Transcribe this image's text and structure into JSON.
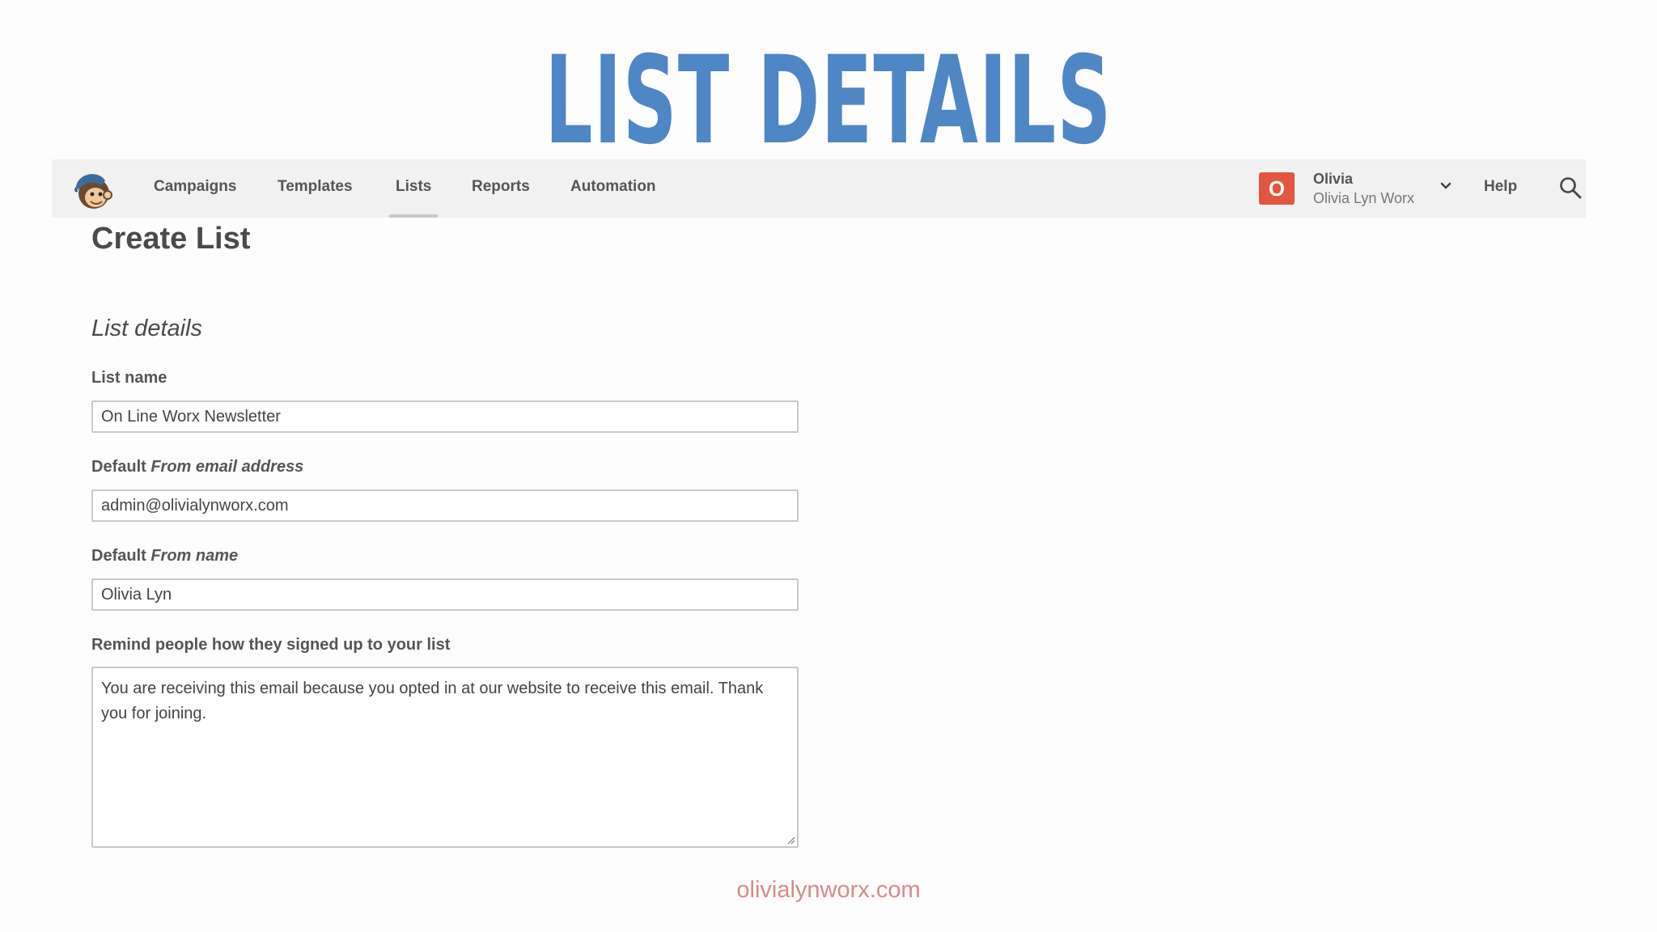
{
  "slide": {
    "title": "LIST DETAILS",
    "footer": "olivialynworx.com"
  },
  "nav": {
    "items": [
      {
        "label": "Campaigns",
        "active": false
      },
      {
        "label": "Templates",
        "active": false
      },
      {
        "label": "Lists",
        "active": true
      },
      {
        "label": "Reports",
        "active": false
      },
      {
        "label": "Automation",
        "active": false
      }
    ],
    "user": {
      "initial": "O",
      "name": "Olivia",
      "account": "Olivia Lyn Worx"
    },
    "help": "Help",
    "icons": {
      "logo": "mailchimp-logo",
      "dropdown": "chevron-down-icon",
      "search": "search-icon"
    }
  },
  "page": {
    "title": "Create List",
    "section": "List details"
  },
  "form": {
    "list_name": {
      "label": "List name",
      "value": "On Line Worx Newsletter"
    },
    "from_email": {
      "label_prefix": "Default ",
      "label_em": "From email address",
      "value": "admin@olivialynworx.com"
    },
    "from_name": {
      "label_prefix": "Default ",
      "label_em": "From name",
      "value": "Olivia Lyn"
    },
    "reminder": {
      "label": "Remind people how they signed up to your list",
      "value": "You are receiving this email because you opted in at our website to receive this email. Thank you for joining."
    }
  },
  "colors": {
    "title": "#4f86c6",
    "avatar": "#e2553f",
    "footer": "#d98a8a",
    "navbar": "#f1f1f1"
  }
}
